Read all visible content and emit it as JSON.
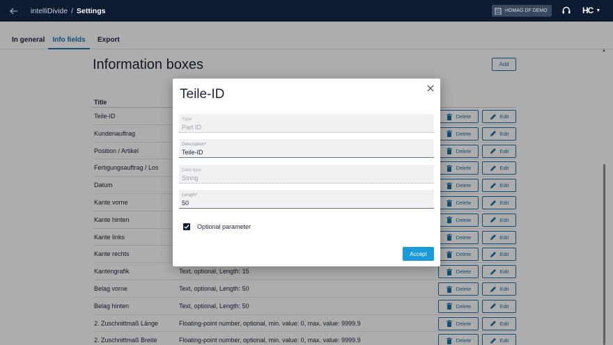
{
  "header": {
    "app_name": "intelliDivide",
    "separator": "/",
    "page": "Settings",
    "tenant": "HOMAG DF DEMO",
    "logo_text": "HC"
  },
  "tabs": [
    {
      "label": "In general",
      "active": false
    },
    {
      "label": "Info fields",
      "active": true
    },
    {
      "label": "Export",
      "active": false
    }
  ],
  "main": {
    "title": "Information boxes",
    "add_label": "Add",
    "column_title": "Title",
    "delete_label": "Delete",
    "edit_label": "Edit",
    "rows": [
      {
        "title": "Teile-ID",
        "desc": ""
      },
      {
        "title": "Kundenauftrag",
        "desc": ""
      },
      {
        "title": "Position / Artikel",
        "desc": ""
      },
      {
        "title": "Fertigungsauftrag / Los",
        "desc": ""
      },
      {
        "title": "Datum",
        "desc": ""
      },
      {
        "title": "Kante vorne",
        "desc": ""
      },
      {
        "title": "Kante hinten",
        "desc": ""
      },
      {
        "title": "Kante links",
        "desc": ""
      },
      {
        "title": "Kante rechts",
        "desc": ""
      },
      {
        "title": "Kantengrafik",
        "desc": "Text, optional, Length: 15"
      },
      {
        "title": "Belag vorne",
        "desc": "Text, optional, Length: 50"
      },
      {
        "title": "Belag hinten",
        "desc": "Text, optional, Length: 50"
      },
      {
        "title": "2. Zuschnittmaß Länge",
        "desc": "Floating-point number, optional, min. value: 0, max. value: 9999.9"
      },
      {
        "title": "2. Zuschnittmaß Breite",
        "desc": "Floating-point number, optional, min. value: 0, max. value: 9999.9"
      }
    ]
  },
  "dialog": {
    "title": "Teile-ID",
    "fields": [
      {
        "label": "Type",
        "value": "Part ID",
        "disabled": true
      },
      {
        "label": "Description*",
        "value": "Teile-ID",
        "disabled": false
      },
      {
        "label": "Data type",
        "value": "String",
        "disabled": true
      },
      {
        "label": "Length*",
        "value": "50",
        "disabled": false
      }
    ],
    "optional_label": "Optional parameter",
    "optional_checked": true,
    "accept_label": "Accept"
  },
  "colors": {
    "topbar": "#0d1b33",
    "accent": "#1a73a8",
    "primary_button": "#1a9bd7"
  }
}
